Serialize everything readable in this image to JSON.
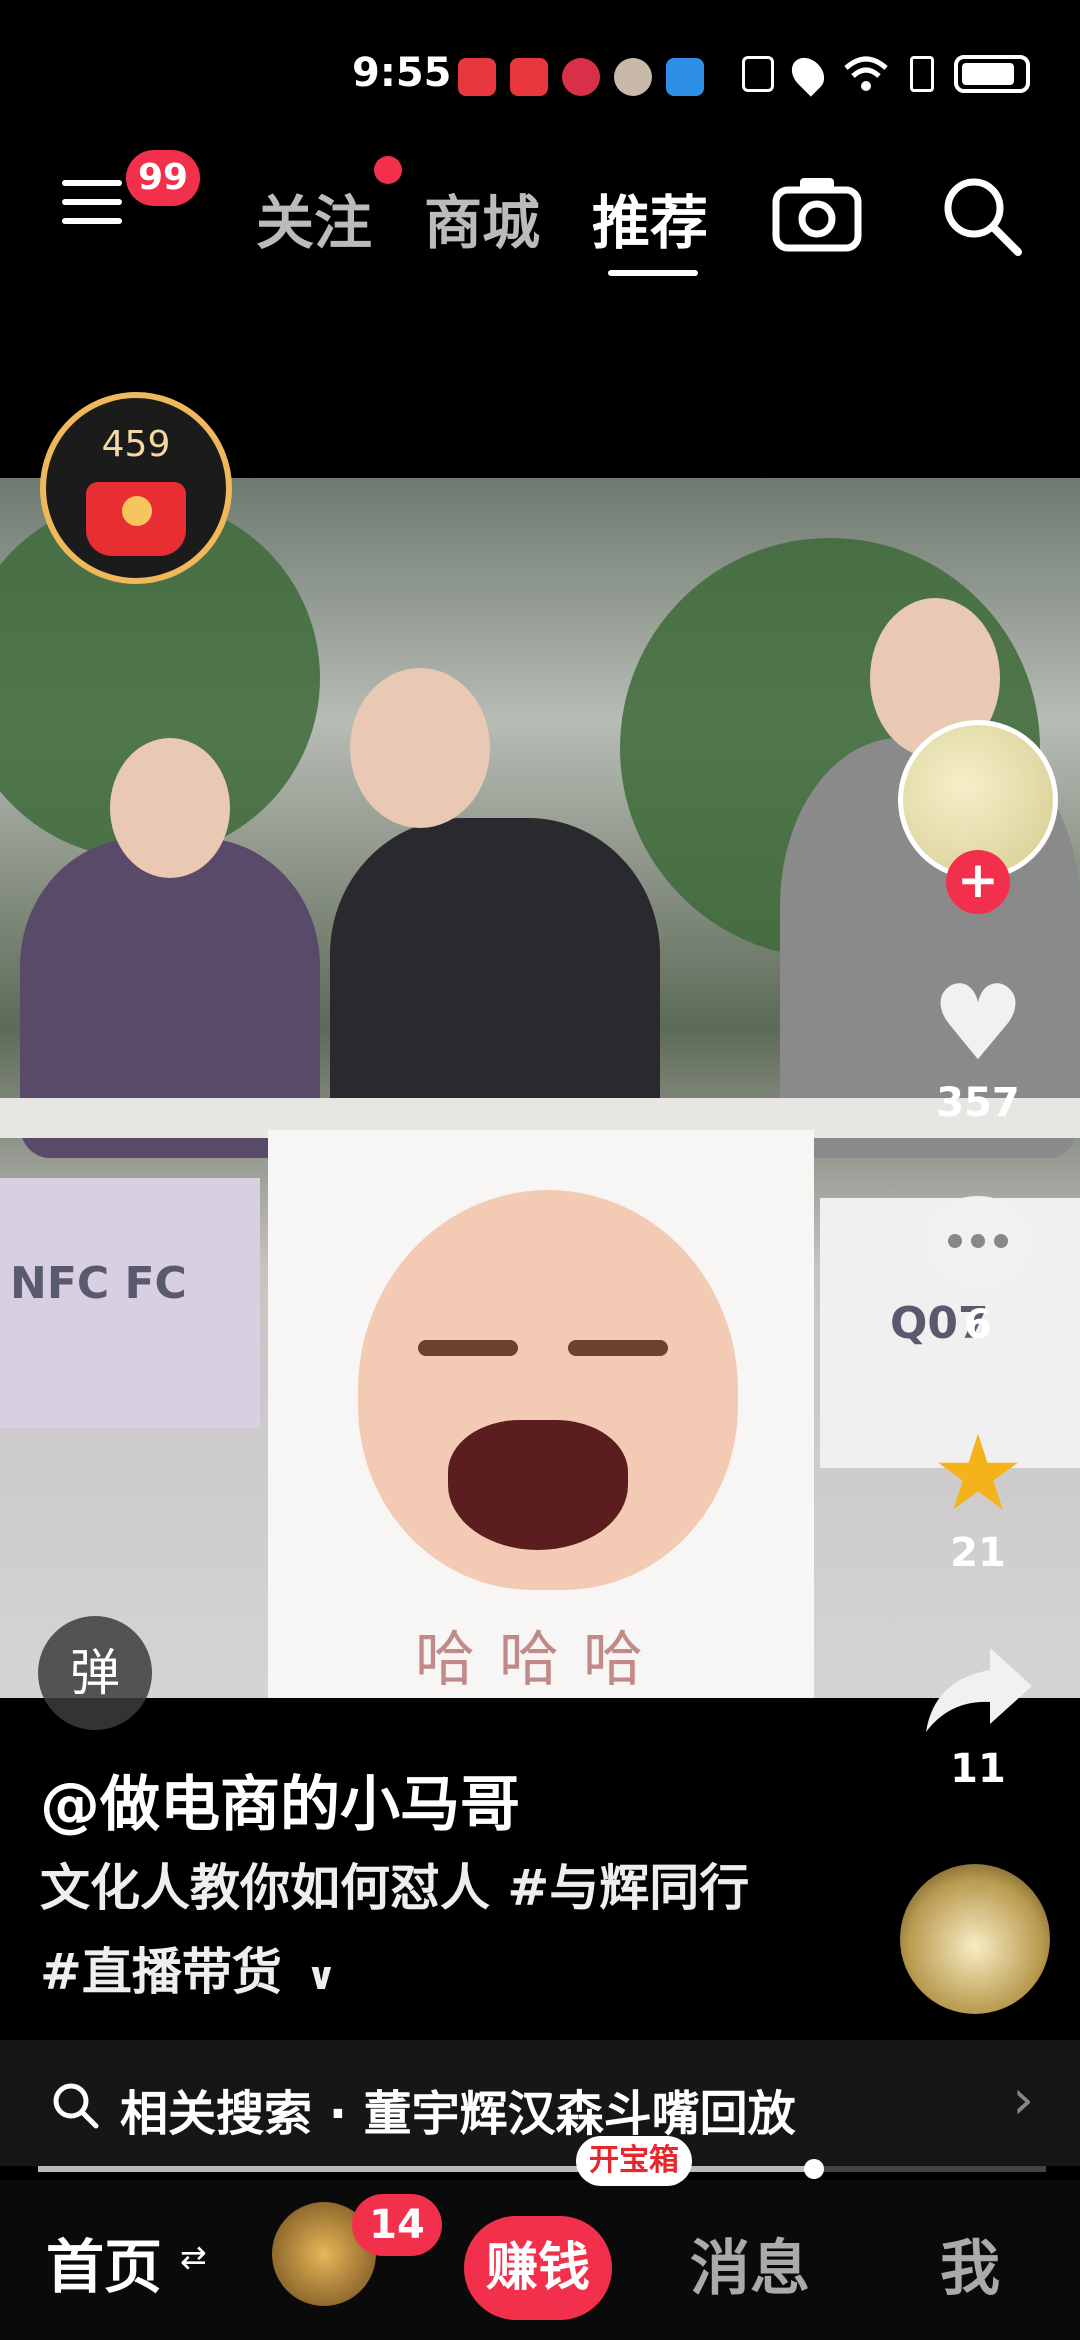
{
  "status_bar": {
    "time": "9:55",
    "notification_icons": [
      "huawei-app-icon",
      "huawei-app-icon",
      "red-app-icon",
      "avatar-app-icon",
      "blue-app-icon"
    ],
    "system_icons": [
      "nfc-icon",
      "location-icon",
      "wifi-icon",
      "alert-icon",
      "battery-icon"
    ]
  },
  "top_nav": {
    "menu_badge": "99",
    "tabs": [
      {
        "label": "关注",
        "active": false,
        "dot": true
      },
      {
        "label": "商城",
        "active": false
      },
      {
        "label": "推荐",
        "active": true
      }
    ]
  },
  "red_packet": {
    "count": "459"
  },
  "video": {
    "sticker_text": "哈哈哈",
    "box_text_left": "NFC FC",
    "box_text_right": "Q07"
  },
  "actions": {
    "like_count": "357",
    "comment_count": "6",
    "favorite_count": "21",
    "share_count": "11"
  },
  "danmu_label": "弹",
  "caption": {
    "author": "@做电商的小马哥",
    "description": "文化人教你如何怼人 #与辉同行 #直播带货"
  },
  "related_search": {
    "text": "相关搜索 · 董宇辉汉森斗嘴回放"
  },
  "progress": {
    "fraction": 0.77
  },
  "bottom_nav": {
    "home": "首页",
    "friends_badge": "14",
    "earn": "赚钱",
    "treasure": "开宝箱",
    "messages": "消息",
    "me": "我"
  },
  "colors": {
    "accent": "#f2304b",
    "gold": "#f0b85a",
    "star": "#f5b31b"
  }
}
